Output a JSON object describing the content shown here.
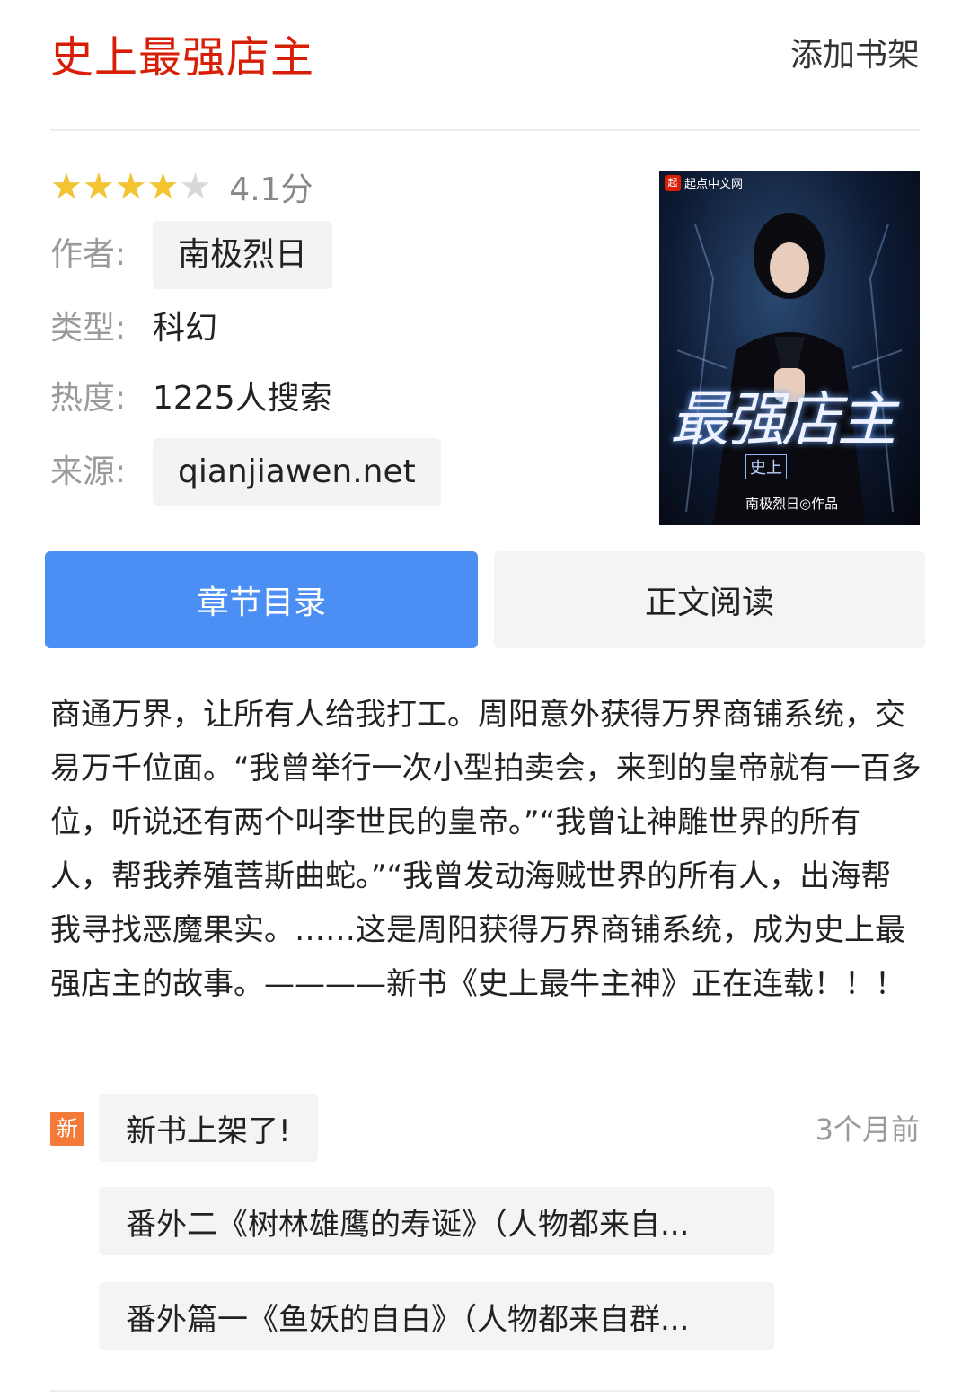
{
  "header": {
    "book_title": "史上最强店主",
    "add_shelf_label": "添加书架"
  },
  "info": {
    "rating": 4.1,
    "score_text": "4.1分",
    "author_label": "作者:",
    "author": "南极烈日",
    "type_label": "类型:",
    "type": "科幻",
    "heat_label": "热度:",
    "heat": "1225人搜索",
    "source_label": "来源:",
    "source": "qianjiawen.net"
  },
  "cover": {
    "logo_mark": "起",
    "logo_text": "起点中文网",
    "title_art": "最强店主",
    "subtitle_art": "史上",
    "author_art": "南极烈日◎作品"
  },
  "buttons": {
    "catalog_label": "章节目录",
    "read_label": "正文阅读"
  },
  "description": "商通万界，让所有人给我打工。周阳意外获得万界商铺系统，交易万千位面。“我曾举行一次小型拍卖会，来到的皇帝就有一百多位，听说还有两个叫李世民的皇帝。”“我曾让神雕世界的所有人，帮我养殖菩斯曲蛇。”“我曾发动海贼世界的所有人，出海帮我寻找恶魔果实。……这是周阳获得万界商铺系统，成为史上最强店主的故事。————新书《史上最牛主神》正在连载！！！",
  "updates": {
    "new_badge": "新",
    "latest_label": "新书上架了!",
    "time": "3个月前",
    "chapters": [
      "番外二《树林雄鹰的寿诞》（人物都来自...",
      "番外篇一《鱼妖的自白》（人物都来自群..."
    ]
  },
  "colors": {
    "title_red": "#d81e06",
    "accent_blue": "#4b8ff5",
    "star_gold": "#f4c430",
    "badge_orange": "#f47a3a"
  }
}
